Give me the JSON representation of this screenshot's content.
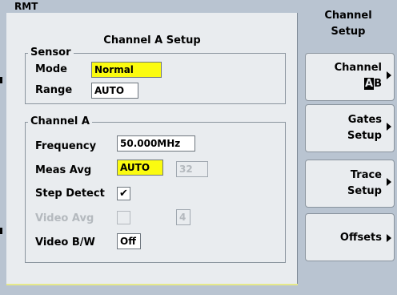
{
  "status": {
    "remote": "RMT"
  },
  "panel": {
    "title": "Channel A Setup",
    "sensor": {
      "legend": "Sensor",
      "mode_label": "Mode",
      "mode_value": "Normal",
      "range_label": "Range",
      "range_value": "AUTO"
    },
    "channel": {
      "legend": "Channel A",
      "frequency_label": "Frequency",
      "frequency_value": "50.000MHz",
      "meas_avg_label": "Meas Avg",
      "meas_avg_mode": "AUTO",
      "meas_avg_count": "32",
      "step_detect_label": "Step Detect",
      "step_detect_checked": "✔",
      "video_avg_label": "Video Avg",
      "video_avg_count": "4",
      "video_bw_label": "Video B/W",
      "video_bw_value": "Off"
    }
  },
  "softkeys": {
    "menu_title_line1": "Channel",
    "menu_title_line2": "Setup",
    "channel_line1": "Channel",
    "channel_selected": "A",
    "channel_other": "B",
    "gates_line1": "Gates",
    "gates_line2": "Setup",
    "trace_line1": "Trace",
    "trace_line2": "Setup",
    "offsets": "Offsets"
  },
  "colors": {
    "highlight": "#fbfb10",
    "panel_bg": "#e9ecef",
    "frame_bg": "#b9c4d1"
  }
}
